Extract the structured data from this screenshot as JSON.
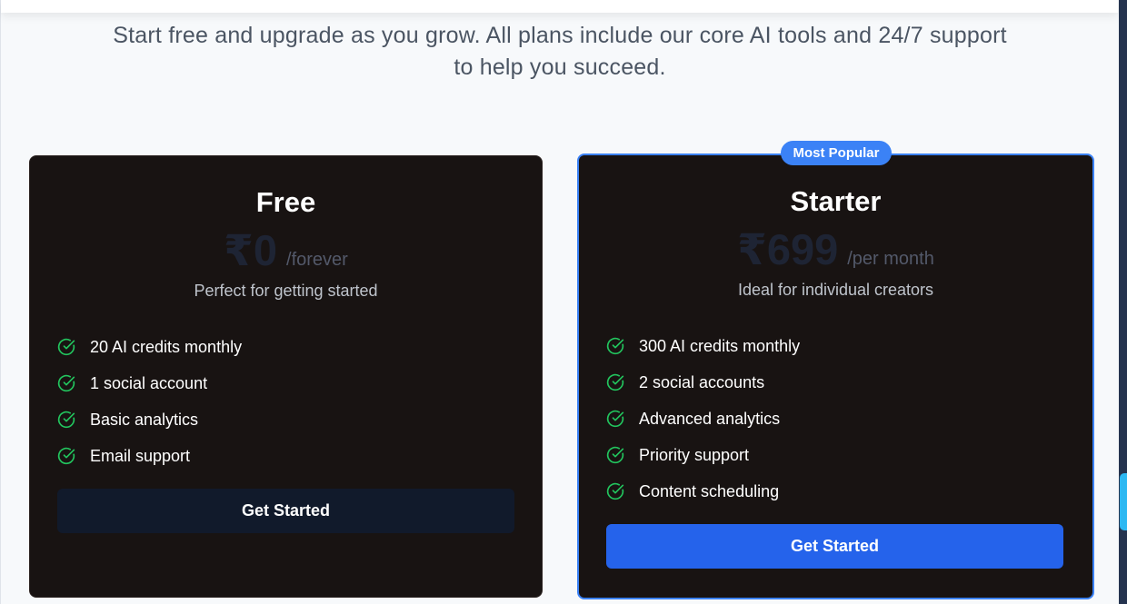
{
  "subtitle": "Start free and upgrade as you grow. All plans include our core AI tools and 24/7 support to help you succeed.",
  "colors": {
    "accent_blue": "#3b82f6",
    "button_blue": "#2563eb",
    "check_green": "#22c55e",
    "card_bg": "#181312"
  },
  "plans": [
    {
      "name": "Free",
      "price": "₹0",
      "period": "/forever",
      "description": "Perfect for getting started",
      "features": [
        "20 AI credits monthly",
        "1 social account",
        "Basic analytics",
        "Email support"
      ],
      "cta": "Get Started",
      "icon": "check-circle-icon"
    },
    {
      "name": "Starter",
      "badge": "Most Popular",
      "price": "₹699",
      "period": "/per month",
      "description": "Ideal for individual creators",
      "features": [
        "300 AI credits monthly",
        "2 social accounts",
        "Advanced analytics",
        "Priority support",
        "Content scheduling"
      ],
      "cta": "Get Started",
      "icon": "check-circle-icon"
    }
  ]
}
